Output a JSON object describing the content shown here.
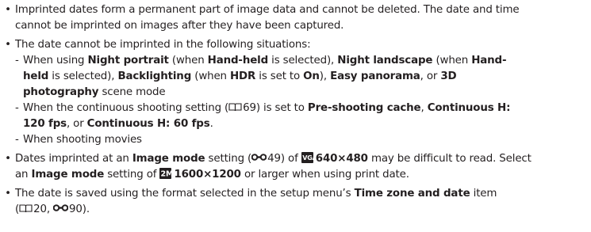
{
  "bullets": {
    "b1": {
      "line1": "Imprinted dates form a permanent part of image data and cannot be deleted. The date and time",
      "line2": "cannot be imprinted on images after they have been captured."
    },
    "b2": {
      "intro": "The date cannot be imprinted in the following situations:",
      "sub1": {
        "t1": "When using ",
        "night_portrait": "Night portrait",
        "t2": " (when ",
        "hand_held_1": "Hand-held",
        "t3": " is selected), ",
        "night_landscape": "Night landscape",
        "t4": " (when ",
        "hand_held_2a": "Hand-",
        "hand_held_2b": "held",
        "t5": " is selected), ",
        "backlighting": "Backlighting",
        "t6": " (when ",
        "hdr": "HDR",
        "t7": " is set to ",
        "on": "On",
        "t8": "), ",
        "easy_panorama": "Easy panorama",
        "t9": ", or ",
        "three_d": "3D",
        "photography": "photography",
        "t10": " scene mode"
      },
      "sub2": {
        "t1": "When the continuous shooting setting (",
        "page": "69",
        "t2": ") is set to ",
        "pre_shooting": "Pre-shooting cache",
        "t3": ", ",
        "cont_h": "Continuous H:",
        "fps120": "120 fps",
        "t4": ", or ",
        "cont_h60": "Continuous H: 60 fps",
        "t5": "."
      },
      "sub3": "When shooting movies"
    },
    "b3": {
      "t1": "Dates imprinted at an ",
      "image_mode": "Image mode",
      "t2": " setting (",
      "page": "49",
      "t3": ") of ",
      "icon1": "VGA",
      "res1": "640×480",
      "t4": " may be difficult to read. Select",
      "t5": "an ",
      "image_mode2": "Image mode",
      "t6": " setting of ",
      "icon2": "2M",
      "res2": "1600×1200",
      "t7": " or larger when using print date."
    },
    "b4": {
      "t1": "The date is saved using the format selected in the setup menu’s ",
      "tz": "Time zone and date",
      "t2": " item",
      "t3": "(",
      "page1": "20, ",
      "page2": "90",
      "t4": ")."
    }
  },
  "glyphs": {
    "bullet": "•",
    "dash": "-"
  },
  "icons": {
    "book": "manual-page-icon",
    "reference": "reference-link-icon"
  },
  "colors": {
    "text": "#231f20"
  }
}
